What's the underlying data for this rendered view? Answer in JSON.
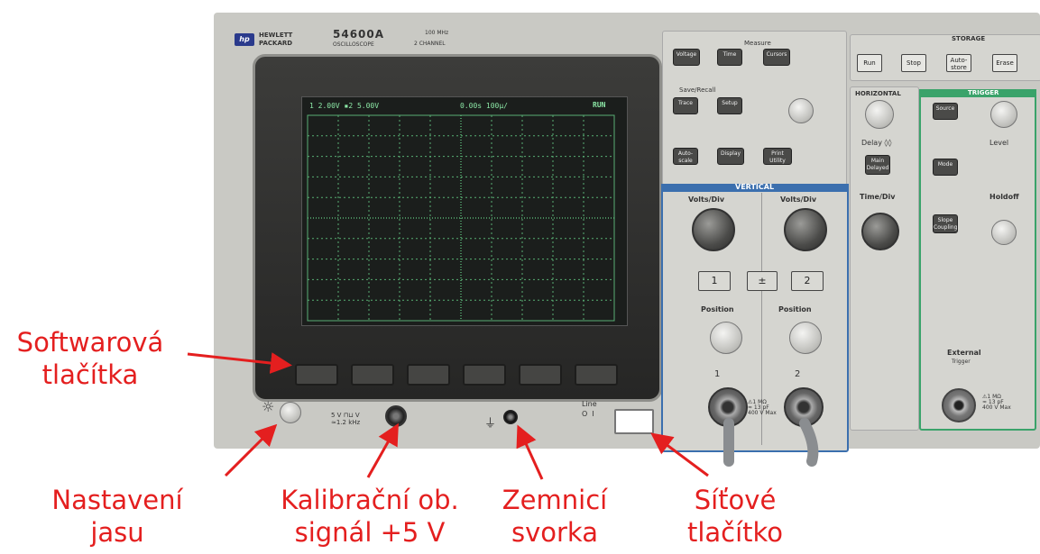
{
  "front_panel": {
    "brand_line1": "HEWLETT",
    "brand_line2": "PACKARD",
    "model": "54600A",
    "model_subtitle": "OSCILLOSCOPE",
    "spec_bandwidth": "100 MHz",
    "spec_channels": "2 CHANNEL"
  },
  "screen": {
    "channel_readout": "1 2.00V ▪2 5.00V",
    "time_readout": "0.00s  100μ/",
    "run_status": "RUN"
  },
  "measure": {
    "title": "Measure",
    "voltage": "Voltage",
    "time": "Time",
    "cursors": "Cursors"
  },
  "save_recall": {
    "title": "Save/Recall",
    "trace": "Trace",
    "setup": "Setup"
  },
  "misc_buttons": {
    "autoscale": "Auto-scale",
    "display": "Display",
    "print_utility": "Print Utility"
  },
  "storage": {
    "title": "STORAGE",
    "run": "Run",
    "stop": "Stop",
    "autostore": "Auto-store",
    "erase": "Erase"
  },
  "horizontal": {
    "title": "HORIZONTAL",
    "delay": "Delay ◊◊",
    "main_delayed": "Main Delayed",
    "time_div": "Time/Div"
  },
  "trigger": {
    "title": "TRIGGER",
    "source": "Source",
    "level": "Level",
    "mode": "Mode",
    "holdoff": "Holdoff",
    "slope_coupling": "Slope Coupling",
    "external": "External",
    "external_sub": "Trigger",
    "ext_spec": "⚠1 MΩ\n≈ 13 pF\n400 V Max"
  },
  "vertical": {
    "title": "VERTICAL",
    "volts_div_1": "Volts/Div",
    "volts_div_2": "Volts/Div",
    "ch1_button": "1",
    "plusminus_button": "±",
    "ch2_button": "2",
    "position_1": "Position",
    "position_2": "Position",
    "ch1_input": "1",
    "ch2_input": "2",
    "input_spec": "⚠1 MΩ\n≈ 13 pF\n400 V Max"
  },
  "bottom": {
    "cal_label": "5 V ⊓⊔ V\n≈1.2 kHz",
    "line_label": "Line",
    "line_states": "O  I"
  },
  "annotations": {
    "softkeys": "Softwarová\ntlačítka",
    "brightness": "Nastavení\njasu",
    "calibration": "Kalibrační ob.\nsignál +5 V",
    "ground": "Zemnicí\nsvorka",
    "power": "Síťové\ntlačítko"
  },
  "colors": {
    "annotation": "#e41f1f",
    "screen_trace": "#7ddf9a",
    "body": "#c9c9c4"
  }
}
